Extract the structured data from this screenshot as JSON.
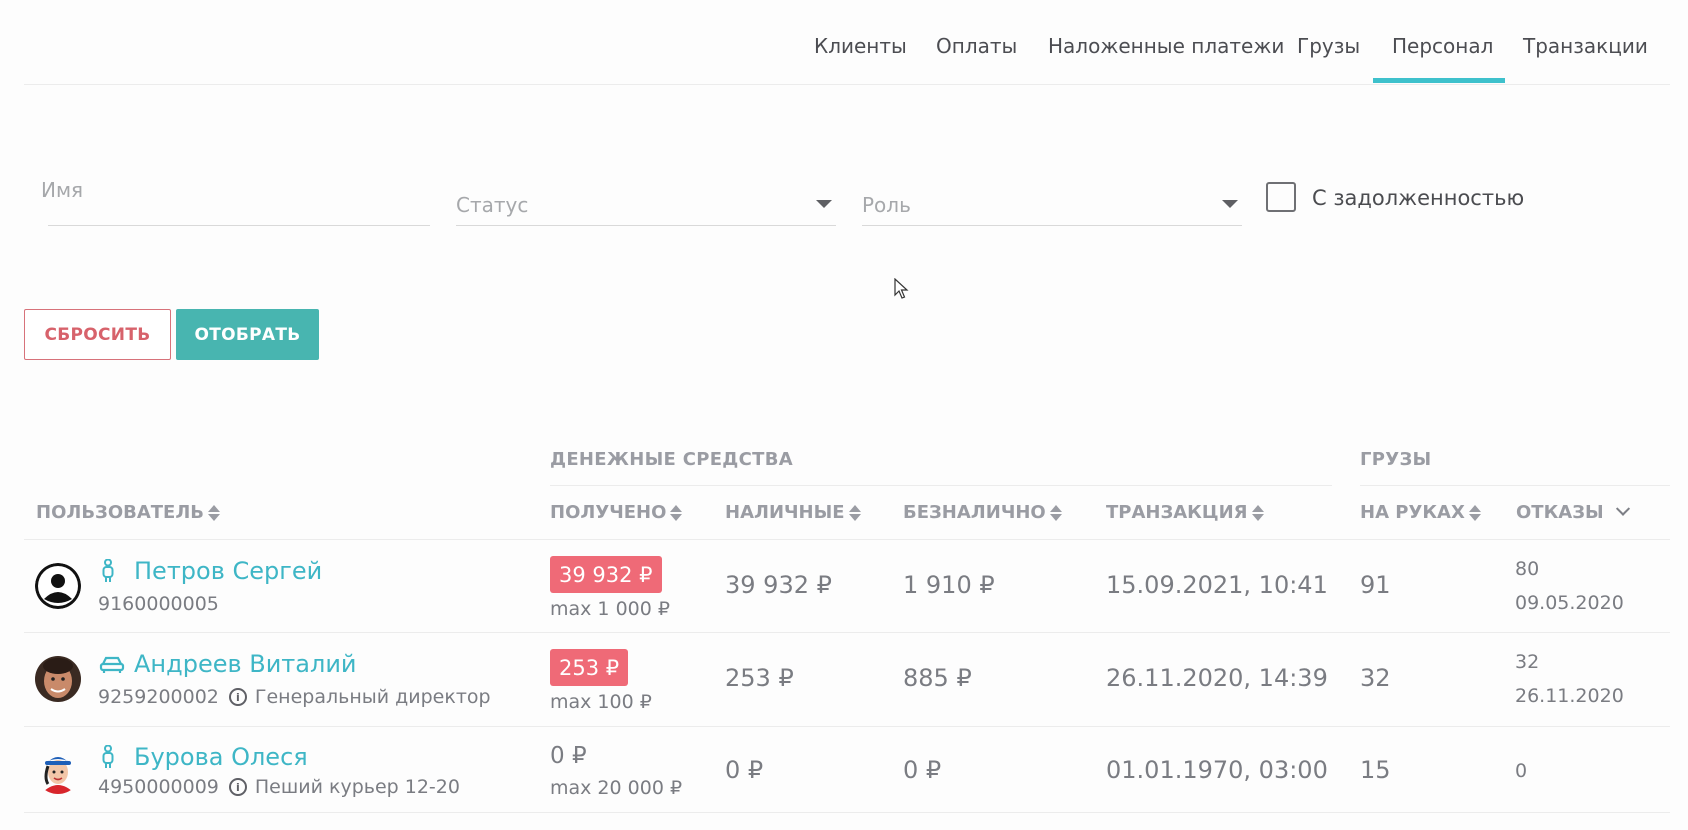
{
  "nav": {
    "tabs": [
      "Клиенты",
      "Оплаты",
      "Наложенные платежи",
      "Грузы",
      "Персонал",
      "Транзакции"
    ],
    "active_tab": "Персонал"
  },
  "filters": {
    "name_placeholder": "Имя",
    "status_placeholder": "Статус",
    "role_placeholder": "Роль",
    "debt_checkbox_label": "С задолженностью",
    "debt_checked": false
  },
  "buttons": {
    "reset": "СБРОСИТЬ",
    "apply": "ОТОБРАТЬ"
  },
  "table": {
    "group_money": "ДЕНЕЖНЫЕ СРЕДСТВА",
    "group_cargo": "ГРУЗЫ",
    "headers": {
      "user": "ПОЛЬЗОВАТЕЛЬ",
      "received": "ПОЛУЧЕНО",
      "cash": "НАЛИЧНЫЕ",
      "cashless": "БЕЗНАЛИЧНО",
      "transaction": "ТРАНЗАКЦИЯ",
      "on_hands": "НА РУКАХ",
      "refusals": "ОТКАЗЫ"
    },
    "rows": [
      {
        "name": "Петров Сергей",
        "user_icon": "person-walking-icon",
        "phone": "9160000005",
        "position": "",
        "received": "39 932 ₽",
        "received_over_limit": true,
        "max": "max 1 000 ₽",
        "cash": "39 932 ₽",
        "cashless": "1 910 ₽",
        "transaction": "15.09.2021, 10:41",
        "on_hands": "91",
        "refusals": "80",
        "refusals_date": "09.05.2020"
      },
      {
        "name": "Андреев Виталий",
        "user_icon": "car-icon",
        "phone": "9259200002",
        "position": "Генеральный директор",
        "received": "253 ₽",
        "received_over_limit": true,
        "max": "max 100 ₽",
        "cash": "253 ₽",
        "cashless": "885 ₽",
        "transaction": "26.11.2020, 14:39",
        "on_hands": "32",
        "refusals": "32",
        "refusals_date": "26.11.2020"
      },
      {
        "name": "Бурова Олеся",
        "user_icon": "person-walking-icon",
        "phone": "4950000009",
        "position": "Пеший курьер 12-20",
        "received": "0 ₽",
        "received_over_limit": false,
        "max": "max 20 000 ₽",
        "cash": "0 ₽",
        "cashless": "0 ₽",
        "transaction": "01.01.1970, 03:00",
        "on_hands": "15",
        "refusals": "0",
        "refusals_date": ""
      }
    ]
  },
  "colors": {
    "accent": "#3ec1cc",
    "name_link": "#3eb6c6",
    "apply_button": "#48b5b0",
    "reset_border": "#d7727a",
    "over_limit_pill": "#ef6a77"
  }
}
